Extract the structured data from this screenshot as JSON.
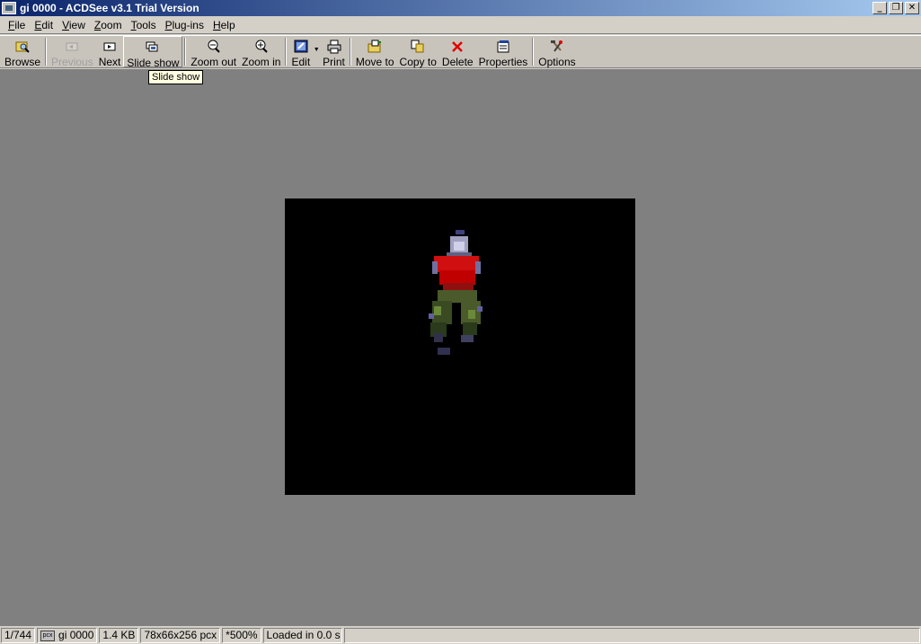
{
  "window": {
    "title": "gi 0000 - ACDSee v3.1 Trial Version",
    "controls": [
      "minimize",
      "restore",
      "close"
    ]
  },
  "menu": [
    {
      "label_u": "F",
      "label_rest": "ile"
    },
    {
      "label_u": "E",
      "label_rest": "dit"
    },
    {
      "label_u": "V",
      "label_rest": "iew"
    },
    {
      "label_u": "Z",
      "label_rest": "oom"
    },
    {
      "label_u": "T",
      "label_rest": "ools"
    },
    {
      "label_u": "P",
      "label_rest": "lug-ins"
    },
    {
      "label_u": "H",
      "label_rest": "elp"
    }
  ],
  "toolbar": {
    "browse": "Browse",
    "previous": "Previous",
    "next": "Next",
    "slideshow": "Slide show",
    "zoom_out": "Zoom out",
    "zoom_in": "Zoom in",
    "edit": "Edit",
    "print": "Print",
    "move_to": "Move to",
    "copy_to": "Copy to",
    "delete": "Delete",
    "properties": "Properties",
    "options": "Options"
  },
  "tooltip": "Slide show",
  "status": {
    "position": "1/744",
    "filename": "gi 0000",
    "filesize": "1.4 KB",
    "dimensions": "78x66x256 pcx",
    "zoom": "*500%",
    "load_time": "Loaded in 0.0 s"
  },
  "colors": {
    "title_start": "#0a246a",
    "title_end": "#a6caf0",
    "viewer_bg": "#808080",
    "image_bg": "#000000",
    "sprite_shirt": "#d01010",
    "sprite_pants": "#4a5a2a"
  }
}
